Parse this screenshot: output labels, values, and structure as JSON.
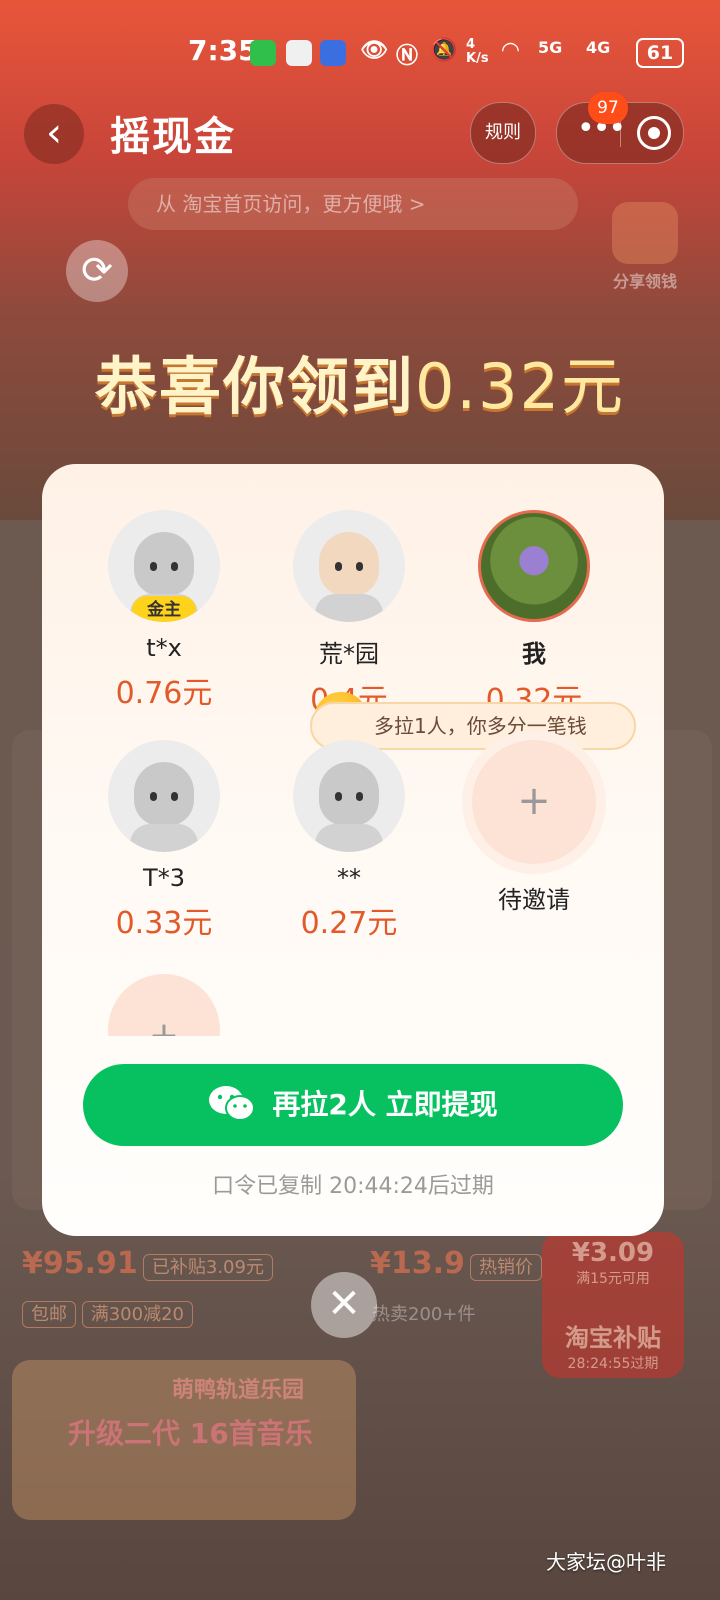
{
  "status_bar": {
    "time": "7:35",
    "net_speed": "4\nK/s",
    "sig5g": "5G",
    "sig4g": "4G",
    "battery": "61"
  },
  "header": {
    "title": "摇现金",
    "rules_label": "规则",
    "badge_count": "97",
    "home_tip": "从 淘宝首页访问，更方便哦 >",
    "share_label": "分享领钱"
  },
  "congrats": {
    "prefix": "恭喜你领到",
    "amount": "0.32元"
  },
  "modal": {
    "members": [
      {
        "name": "t*x",
        "amount": "0.76元",
        "badge": "金主"
      },
      {
        "name": "荒*园",
        "amount": "0.4元"
      },
      {
        "name": "我",
        "amount": "0.32元"
      },
      {
        "name": "T*3",
        "amount": "0.33元"
      },
      {
        "name": "**",
        "amount": "0.27元"
      }
    ],
    "invite_label": "待邀请",
    "more_tip": "多拉1人，你多分一笔钱",
    "cta_label": "再拉2人 立即提现",
    "expire_note": "口令已复制 20:44:24后过期"
  },
  "background": {
    "price1": "¥95.91",
    "tag1": "已补贴3.09元",
    "free_ship": "包邮",
    "discount": "满300减20",
    "price2": "¥13.9",
    "tag2": "热销价",
    "sold": "热卖200+件",
    "subsidy_amount": "¥3.09",
    "subsidy_cond": "满15元可用",
    "subsidy_title": "淘宝补贴",
    "subsidy_time": "28:24:55过期",
    "banner_title": "萌鸭轨道乐园",
    "banner_sub": "升级二代 16首音乐"
  },
  "watermark": "大家坛@叶非"
}
